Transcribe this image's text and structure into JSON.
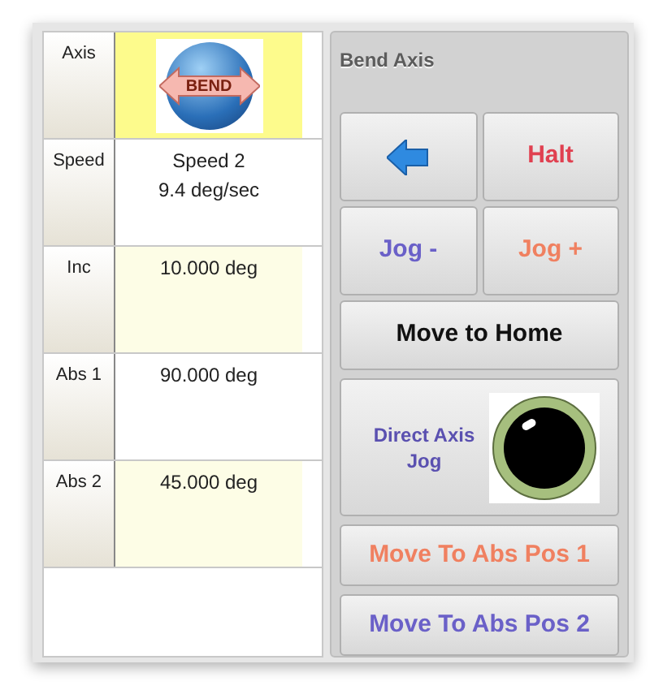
{
  "table": {
    "rows": [
      {
        "label": "Axis",
        "kind": "logo",
        "value": "BEND",
        "selected": true
      },
      {
        "label": "Speed",
        "kind": "text",
        "value": "Speed 2",
        "detail": "9.4 deg/sec",
        "selected": false
      },
      {
        "label": "Inc",
        "kind": "text",
        "value": "10.000 deg",
        "selected": false
      },
      {
        "label": "Abs 1",
        "kind": "text",
        "value": "90.000 deg",
        "selected": false
      },
      {
        "label": "Abs 2",
        "kind": "text",
        "value": "45.000 deg",
        "selected": false
      }
    ]
  },
  "panel": {
    "title": "Bend Axis",
    "buttons": [
      {
        "kind": "arrow"
      },
      {
        "kind": "half",
        "label": "Halt",
        "color": "#e04050"
      },
      {
        "kind": "half",
        "label": "Jog -",
        "color": "#6a60c8"
      },
      {
        "kind": "half",
        "label": "Jog +",
        "color": "#f08060"
      },
      {
        "kind": "wide",
        "label": "Move to Home",
        "color": "#111111"
      },
      {
        "kind": "jog",
        "label": "Direct Axis Jog",
        "color": "#5a50b0"
      },
      {
        "kind": "long",
        "label": "Move To Abs Pos 1",
        "color": "#f08060"
      },
      {
        "kind": "long",
        "label": "Move To Abs Pos 2",
        "color": "#6a60c8"
      }
    ]
  }
}
